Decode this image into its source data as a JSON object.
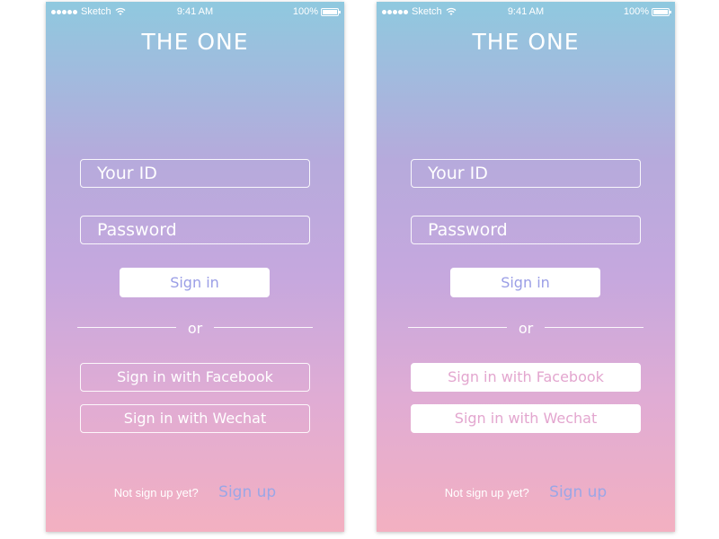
{
  "status_bar": {
    "carrier": "Sketch",
    "time": "9:41 AM",
    "battery": "100%"
  },
  "app": {
    "title": "THE ONE"
  },
  "login": {
    "id_placeholder": "Your ID",
    "password_placeholder": "Password",
    "sign_in_label": "Sign in",
    "divider_text": "or",
    "facebook_label": "Sign in with Facebook",
    "wechat_label": "Sign in with Wechat",
    "footer_prompt": "Not sign up yet?",
    "sign_up_label": "Sign up"
  },
  "colors": {
    "gradient_top": "#8fc9df",
    "gradient_mid": "#c6a8de",
    "gradient_bottom": "#f3b0c1",
    "accent_blue": "#9a9ee6",
    "accent_pink": "#e3a6cf"
  },
  "variants": [
    {
      "name": "outline-social-buttons"
    },
    {
      "name": "filled-social-buttons"
    }
  ]
}
